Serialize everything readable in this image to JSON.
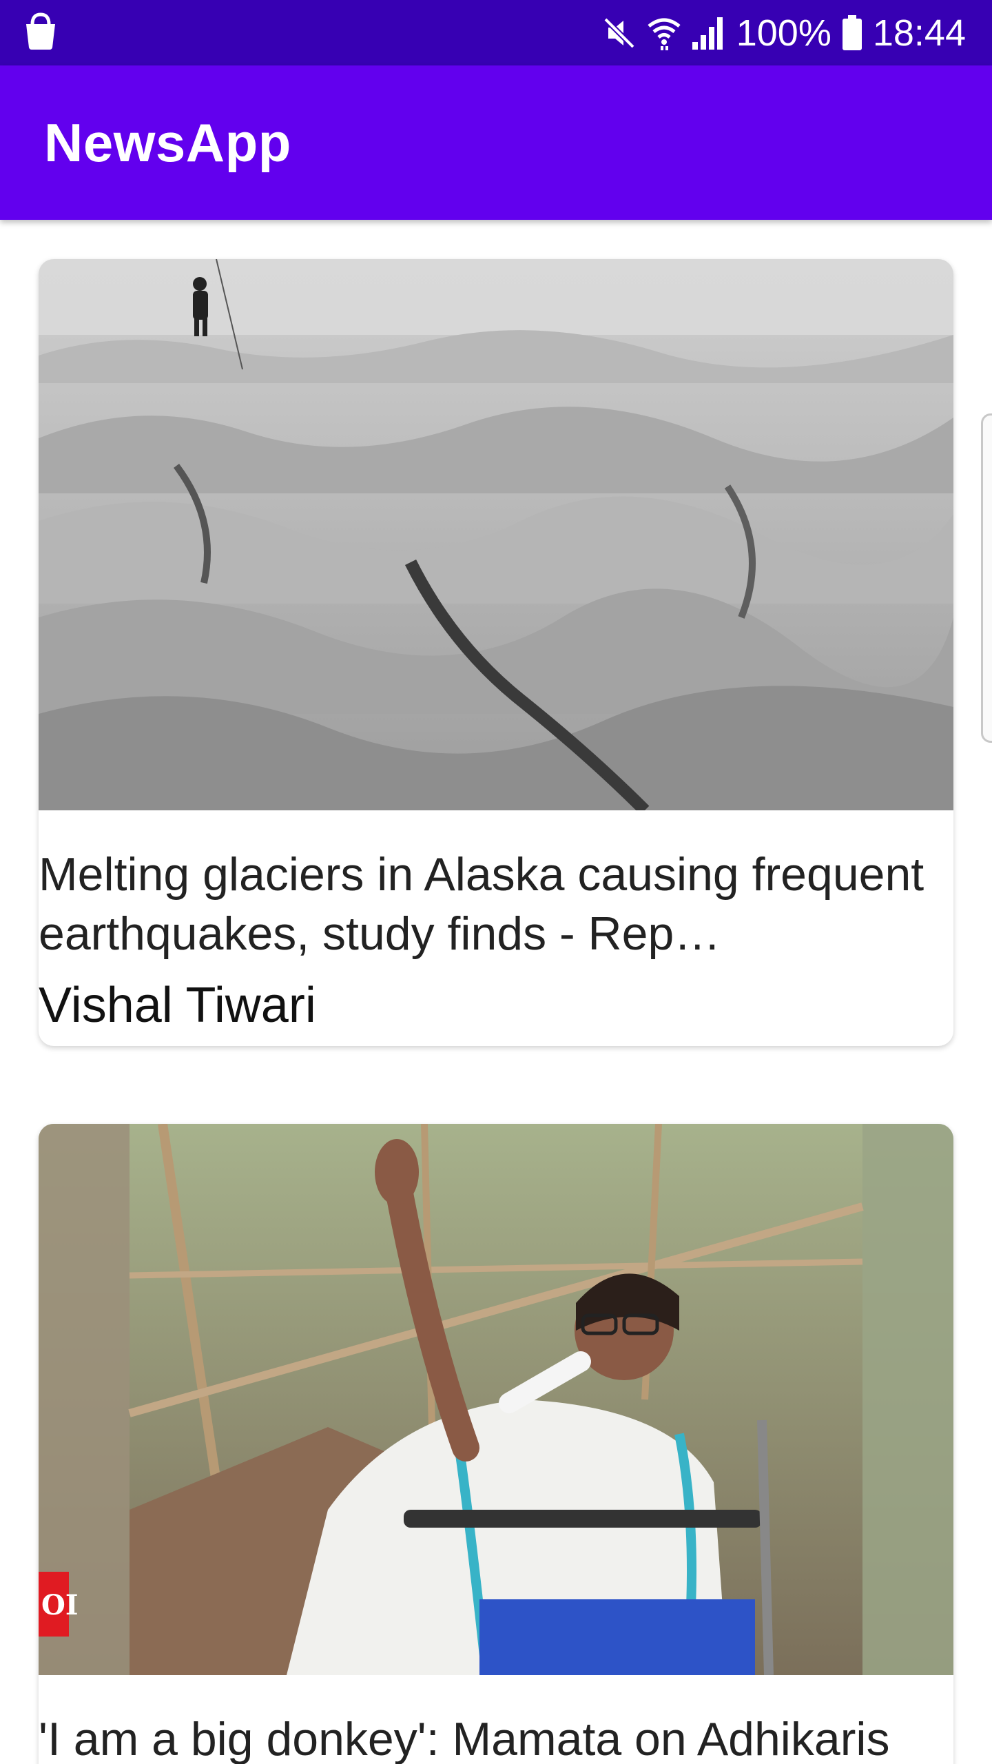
{
  "status_bar": {
    "left_icon": "shopping-bag-icon",
    "mute_icon": "mute-icon",
    "wifi_icon": "wifi-icon",
    "signal_icon": "signal-icon",
    "battery_text": "100%",
    "battery_icon": "battery-icon",
    "time": "18:44"
  },
  "app_bar": {
    "title": "NewsApp"
  },
  "articles": [
    {
      "image": "glacier-photo",
      "title": "Melting glaciers in Alaska causing frequent earthquakes, study finds - Rep…",
      "author": "Vishal Tiwari"
    },
    {
      "image": "politician-speaking-photo",
      "title": "'I am a big donkey': Mamata on Adhikaris",
      "badge_text": "OI"
    }
  ],
  "colors": {
    "status_bar": "#3700b3",
    "app_bar": "#6200ee",
    "background": "#ffffff"
  }
}
